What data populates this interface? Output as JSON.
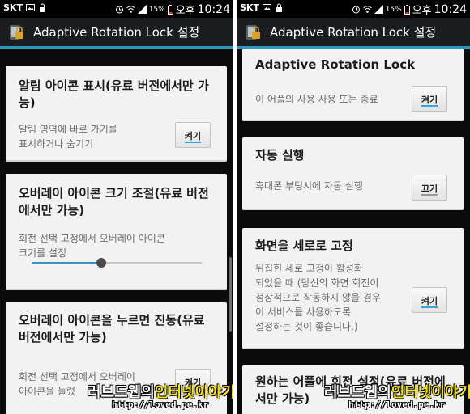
{
  "status_bar": {
    "carrier": "SKT",
    "battery_percent": "15%",
    "ampm": "오후",
    "time": "10:24"
  },
  "app": {
    "title": "Adaptive Rotation Lock 설정"
  },
  "left_screen": {
    "notification_icon": {
      "title": "알림 아이콘 표시(유료 버전에서만 가능)",
      "desc_line1": "알림 영역에 바로 가기를",
      "desc_line2": "표시하거나 숨기기",
      "toggle": "켜기",
      "toggle_on": true
    },
    "overlay_size": {
      "title": "오버레이 아이콘 크기 조절(유료 버전에서만 가능)",
      "desc_line1": "회전 선택 고정에서 오버레이 아이콘",
      "desc_line2": "크기를 설정",
      "slider_value_percent": 41
    },
    "overlay_vibrate": {
      "title": "오버레이 아이콘을 누르면 진동(유료 버전에서만 가능)",
      "desc_line1": "회전 선택 고정에서 오버레이",
      "desc_line2": "아이콘을 눌렀",
      "toggle": "켜기"
    }
  },
  "right_screen": {
    "adaptive": {
      "title": "Adaptive Rotation Lock",
      "desc": "이 어플의 사용 사용 또는 종료",
      "toggle": "켜기",
      "toggle_on": true
    },
    "autostart": {
      "title": "자동 실행",
      "desc": "휴대폰 부팅시에 자동 실행",
      "toggle": "끄기",
      "toggle_on": false
    },
    "portrait_lock": {
      "title": "화면을 세로로 고정",
      "desc_line1": "뒤집힌 세로 고정이 활성화",
      "desc_line2": "되었을 때 (당신의 화면 회전이",
      "desc_line3": "정상적으로 작동하지 않을 경우",
      "desc_line4": "이 서비스를 사용하도록",
      "desc_line5": "설정하는 것이 좋습니다.)",
      "toggle": "켜기",
      "toggle_on": true
    },
    "desired_apps": {
      "title": "원하는 어플에 회전 설정(유료 버전에서만 가능)"
    }
  },
  "watermark": {
    "part1": "러브드웹의",
    "part2": "인터넷이야기",
    "url": "http://loved.pe.kr"
  },
  "colors": {
    "accent": "#2f94c0",
    "card": "#f2f2f2",
    "actionbar": "#1b1d20"
  }
}
